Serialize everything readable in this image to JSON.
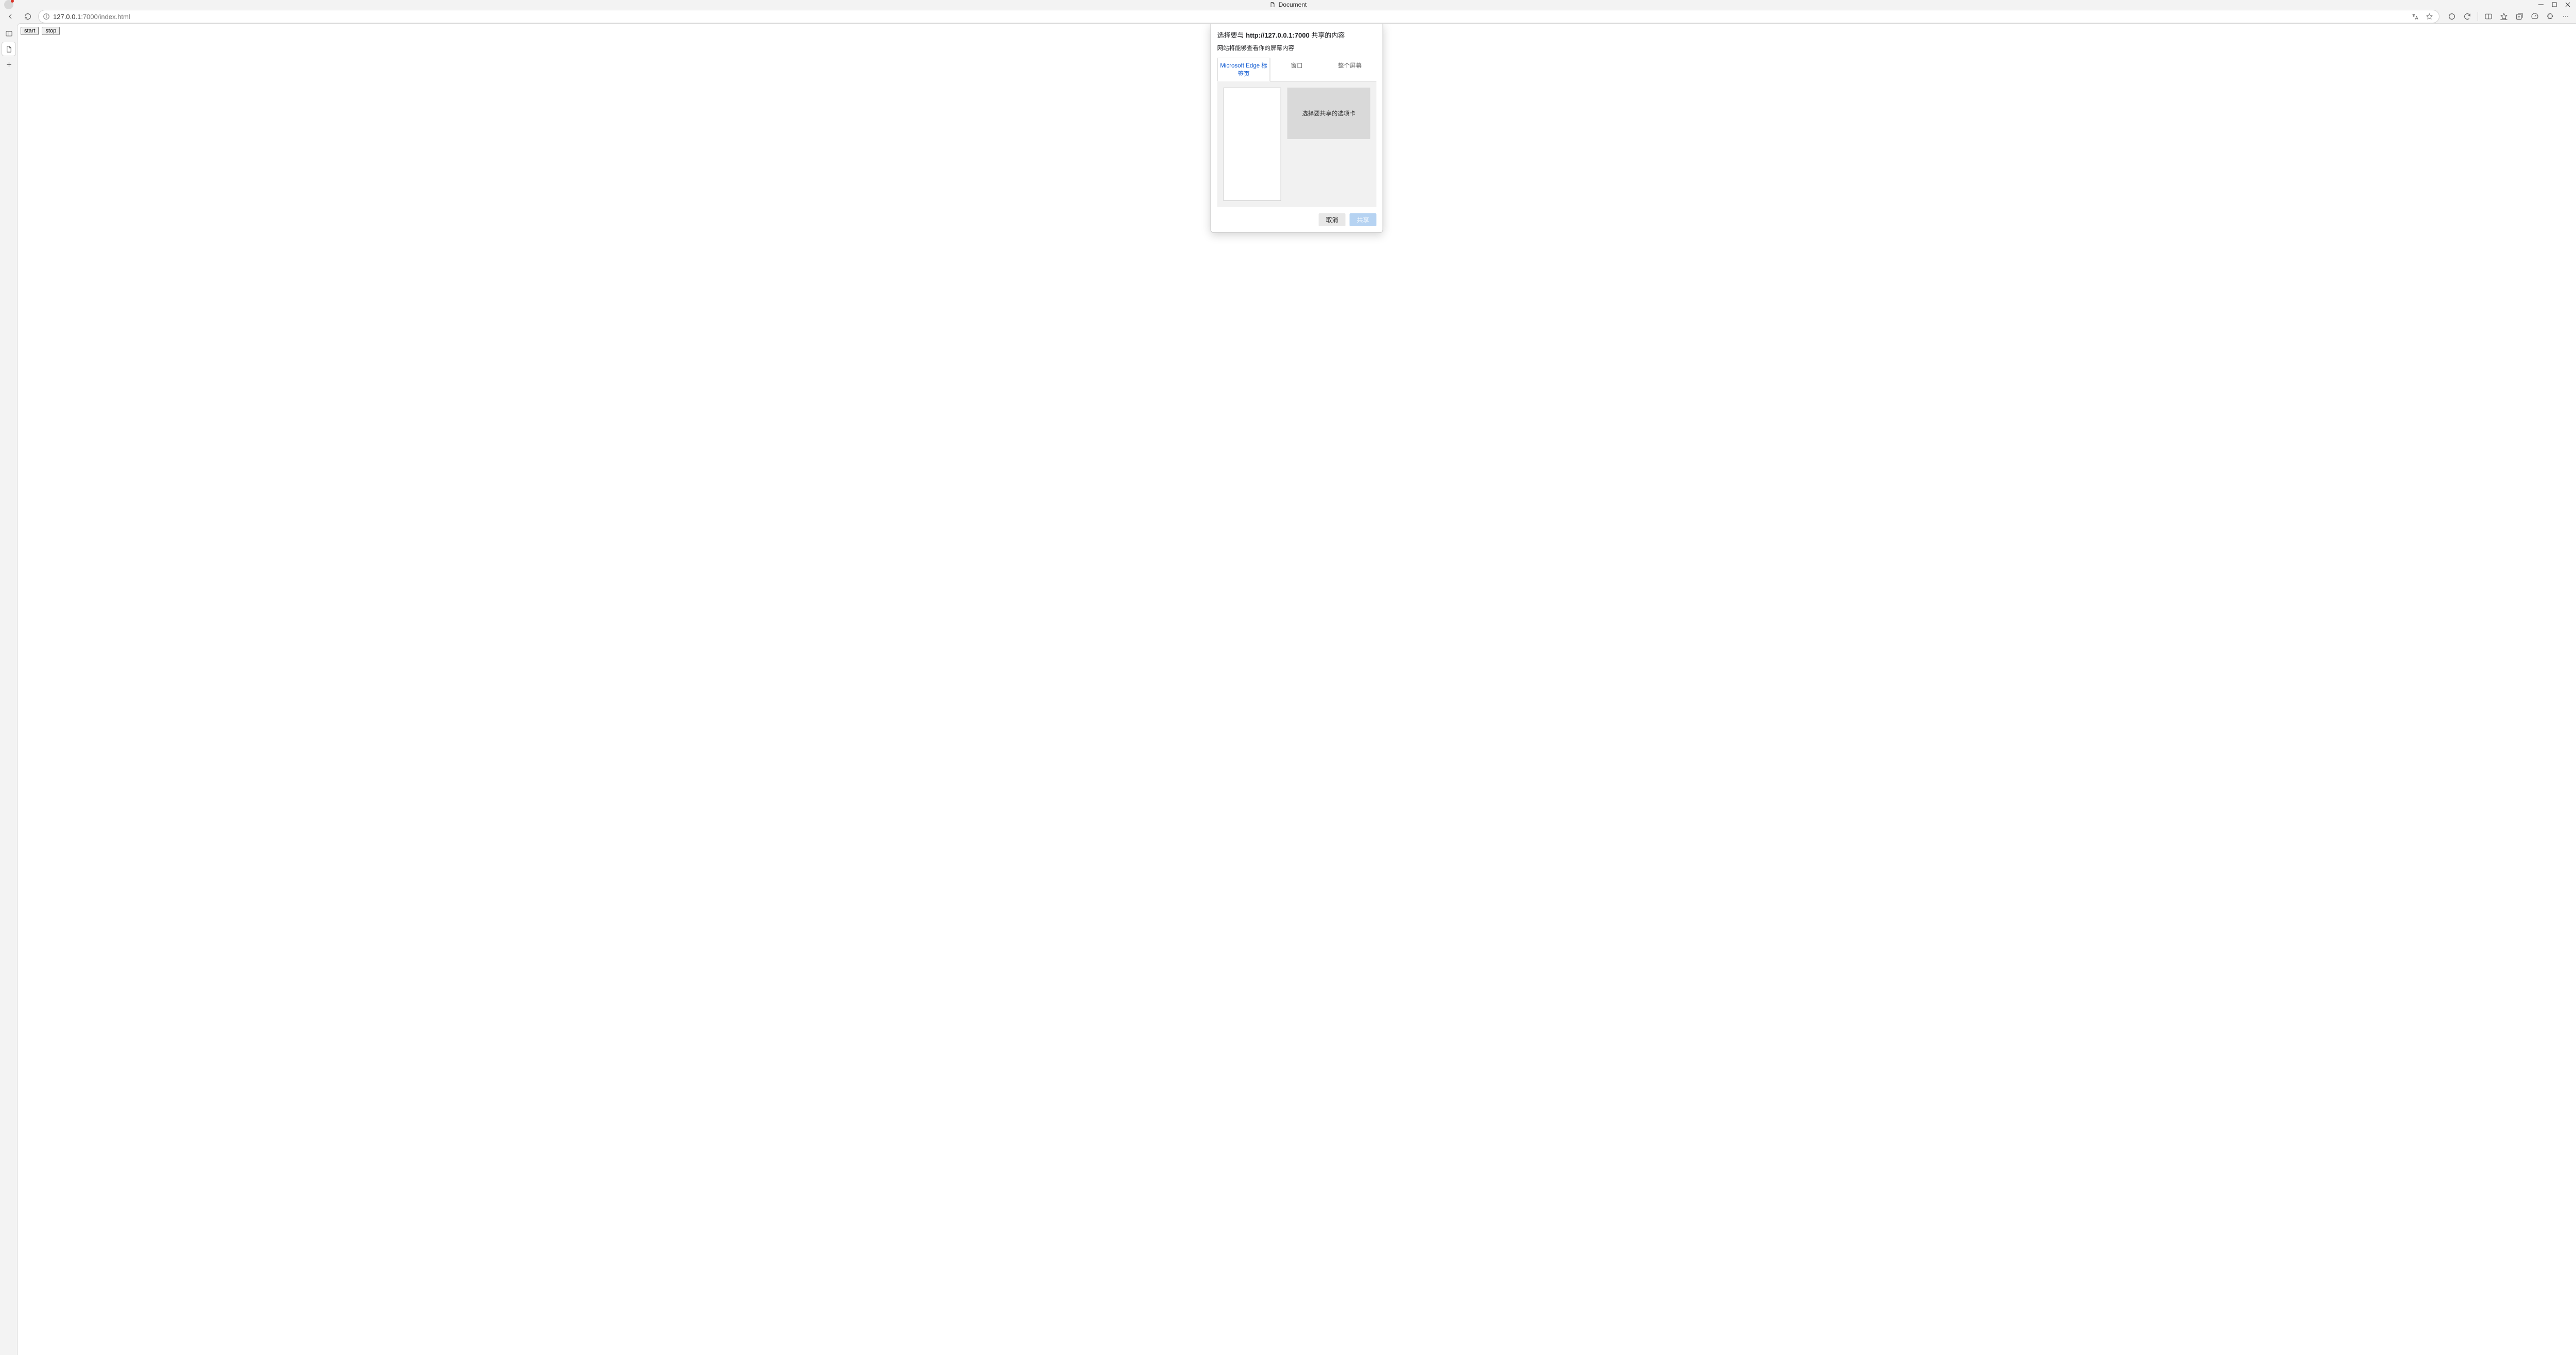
{
  "window": {
    "title": "Document",
    "minimize": "—",
    "maximize": "▢",
    "close": "✕"
  },
  "toolbar": {
    "url_host": "127.0.0.1",
    "url_rest": ":7000/index.html"
  },
  "page": {
    "start_label": "start",
    "stop_label": "stop"
  },
  "dialog": {
    "title_prefix": "选择要与 ",
    "title_bold": "http://127.0.0.1:7000",
    "title_suffix": " 共享的内容",
    "subtitle": "网站将能够查看你的屏幕内容",
    "tabs": {
      "edge": "Microsoft Edge 标签页",
      "window": "窗口",
      "screen": "整个屏幕"
    },
    "preview_label": "选择要共享的选项卡",
    "cancel": "取消",
    "share": "共享"
  }
}
